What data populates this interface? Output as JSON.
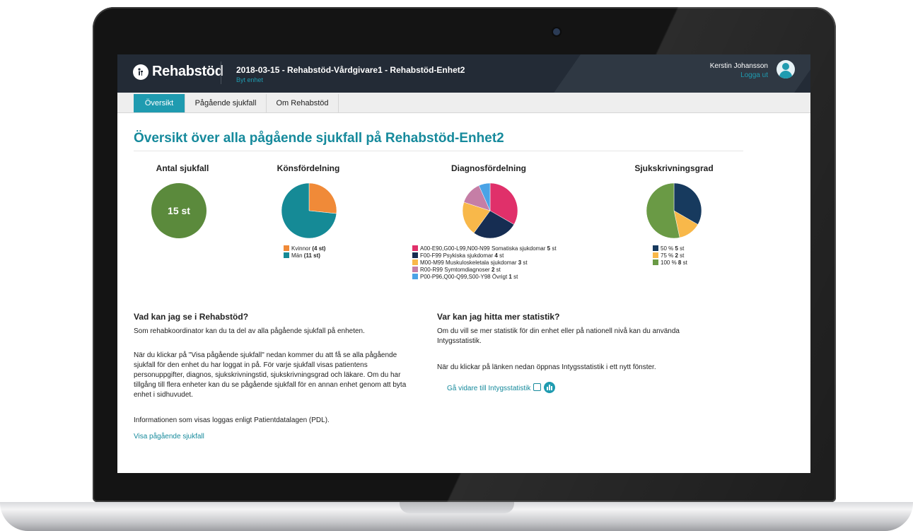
{
  "header": {
    "logo_text": "Rehabstöd",
    "logo_icon": "rehabstod-logo-icon",
    "unit_title": "2018-03-15 - Rehabstöd-Vårdgivare1 - Rehabstöd-Enhet2",
    "unit_switch": "Byt enhet",
    "user_name": "Kerstin Johansson",
    "logout": "Logga ut",
    "avatar_icon": "user-avatar-icon"
  },
  "nav": {
    "tabs": [
      {
        "label": "Översikt",
        "active": true
      },
      {
        "label": "Pågående sjukfall",
        "active": false
      },
      {
        "label": "Om Rehabstöd",
        "active": false
      }
    ]
  },
  "main": {
    "title": "Översikt över alla pågående sjukfall på Rehabstöd-Enhet2",
    "charts": {
      "total": {
        "title": "Antal sjukfall",
        "value": "15 st"
      },
      "gender": {
        "title": "Könsfördelning",
        "legend": [
          {
            "label": "Kvinnor",
            "count": "(4 st)",
            "color": "#f08a38"
          },
          {
            "label": "Män",
            "count": "(11 st)",
            "color": "#158a96"
          }
        ]
      },
      "diagnosis": {
        "title": "Diagnosfördelning",
        "legend": [
          {
            "label": "A00-E90,G00-L99,N00-N99 Somatiska sjukdomar",
            "count": "5",
            "unit": "st",
            "color": "#e0306a"
          },
          {
            "label": "F00-F99 Psykiska sjukdomar",
            "count": "4",
            "unit": "st",
            "color": "#162d52"
          },
          {
            "label": "M00-M99 Muskuloskeletala sjukdomar",
            "count": "3",
            "unit": "st",
            "color": "#f8b84a"
          },
          {
            "label": "R00-R99 Symtomdiagnoser",
            "count": "2",
            "unit": "st",
            "color": "#c57ea6"
          },
          {
            "label": "P00-P96,Q00-Q99,S00-Y98 Övrigt",
            "count": "1",
            "unit": "st",
            "color": "#4aa3e6"
          }
        ]
      },
      "degree": {
        "title": "Sjukskrivningsgrad",
        "legend": [
          {
            "label": "50 %",
            "count": "5",
            "unit": "st",
            "color": "#173a5e"
          },
          {
            "label": "75 %",
            "count": "2",
            "unit": "st",
            "color": "#f8b84a"
          },
          {
            "label": "100 %",
            "count": "8",
            "unit": "st",
            "color": "#6a9a45"
          }
        ]
      }
    },
    "info_left": {
      "heading": "Vad kan jag se i Rehabstöd?",
      "p1": "Som rehabkoordinator kan du ta del av alla pågående sjukfall på enheten.",
      "p2_lines": [
        "När du klickar på \"Visa pågående sjukfall\" nedan kommer du att få se alla pågående",
        "sjukfall för den enhet du har loggat in på. För varje sjukfall visas patientens",
        "personuppgifter, diagnos, sjukskrivningstid, sjukskrivningsgrad och läkare. Om du har",
        "tillgång till flera enheter kan du se pågående sjukfall för en annan enhet genom att byta",
        "enhet i sidhuvudet."
      ],
      "p3": "Informationen som visas loggas enligt Patientdatalagen (PDL).",
      "link": "Visa pågående sjukfall"
    },
    "info_right": {
      "heading": "Var kan jag hitta mer statistik?",
      "p1_lines": [
        "Om du vill se mer statistik för din enhet eller på nationell nivå kan du använda",
        "Intygsstatistik."
      ],
      "p2": "När du klickar på länken nedan öppnas Intygsstatistik i ett nytt fönster.",
      "link": "Gå vidare till Intygsstatistik",
      "icons": [
        "external-link-icon",
        "statistics-icon"
      ]
    }
  },
  "chart_data": [
    {
      "type": "pie",
      "title": "Könsfördelning",
      "categories": [
        "Kvinnor",
        "Män"
      ],
      "values": [
        4,
        11
      ]
    },
    {
      "type": "pie",
      "title": "Diagnosfördelning",
      "categories": [
        "A00-E90,G00-L99,N00-N99 Somatiska sjukdomar",
        "F00-F99 Psykiska sjukdomar",
        "M00-M99 Muskuloskeletala sjukdomar",
        "R00-R99 Symtomdiagnoser",
        "P00-P96,Q00-Q99,S00-Y98 Övrigt"
      ],
      "values": [
        5,
        4,
        3,
        2,
        1
      ]
    },
    {
      "type": "pie",
      "title": "Sjukskrivningsgrad",
      "categories": [
        "50 %",
        "75 %",
        "100 %"
      ],
      "values": [
        5,
        2,
        8
      ]
    }
  ]
}
